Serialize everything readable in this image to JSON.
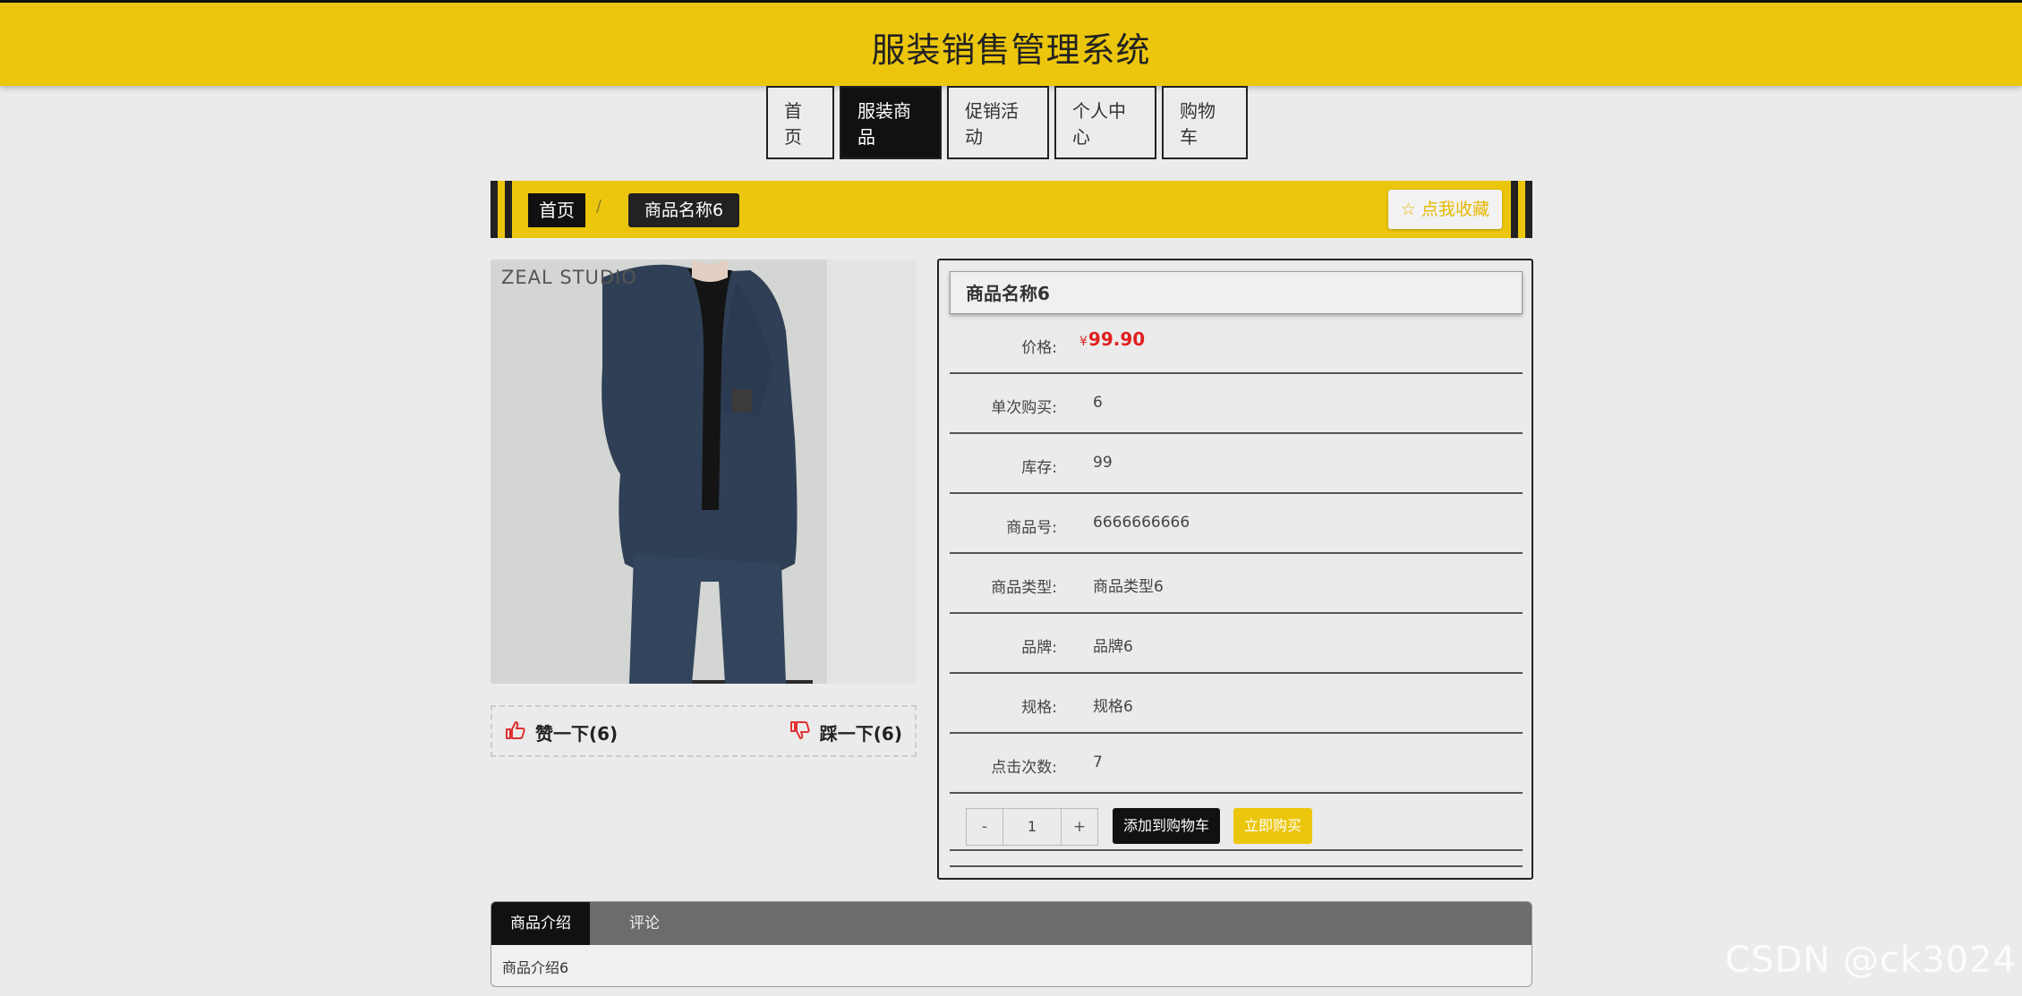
{
  "header": {
    "title": "服装销售管理系统"
  },
  "nav": {
    "items": [
      {
        "label": "首页"
      },
      {
        "label": "服装商品"
      },
      {
        "label": "促销活动"
      },
      {
        "label": "个人中心"
      },
      {
        "label": "购物车"
      }
    ],
    "active_index": 1
  },
  "breadcrumb": {
    "home": "首页",
    "separator": "/",
    "current": "商品名称6",
    "favorite": "☆ 点我收藏"
  },
  "photo": {
    "brand_text": "ZEAL STUDIO"
  },
  "votes": {
    "like": "赞一下(6)",
    "dislike": "踩一下(6)"
  },
  "product": {
    "name": "商品名称6",
    "currency": "¥",
    "price": "99.90",
    "fields": [
      {
        "label": "价格:"
      },
      {
        "label": "单次购买:",
        "value": "6"
      },
      {
        "label": "库存:",
        "value": "99"
      },
      {
        "label": "商品号:",
        "value": "6666666666"
      },
      {
        "label": "商品类型:",
        "value": "商品类型6"
      },
      {
        "label": "品牌:",
        "value": "品牌6"
      },
      {
        "label": "规格:",
        "value": "规格6"
      },
      {
        "label": "点击次数:",
        "value": "7"
      }
    ]
  },
  "actions": {
    "minus": "-",
    "quantity": "1",
    "plus": "+",
    "add_to_cart": "添加到购物车",
    "buy_now": "立即购买"
  },
  "tabs": {
    "items": [
      {
        "label": "商品介绍"
      },
      {
        "label": "评论"
      }
    ],
    "content": "商品介绍6"
  },
  "watermark": "CSDN @ck3024",
  "colors": {
    "accent": "#ecc60c",
    "dark": "#111111",
    "price": "#e02020"
  }
}
